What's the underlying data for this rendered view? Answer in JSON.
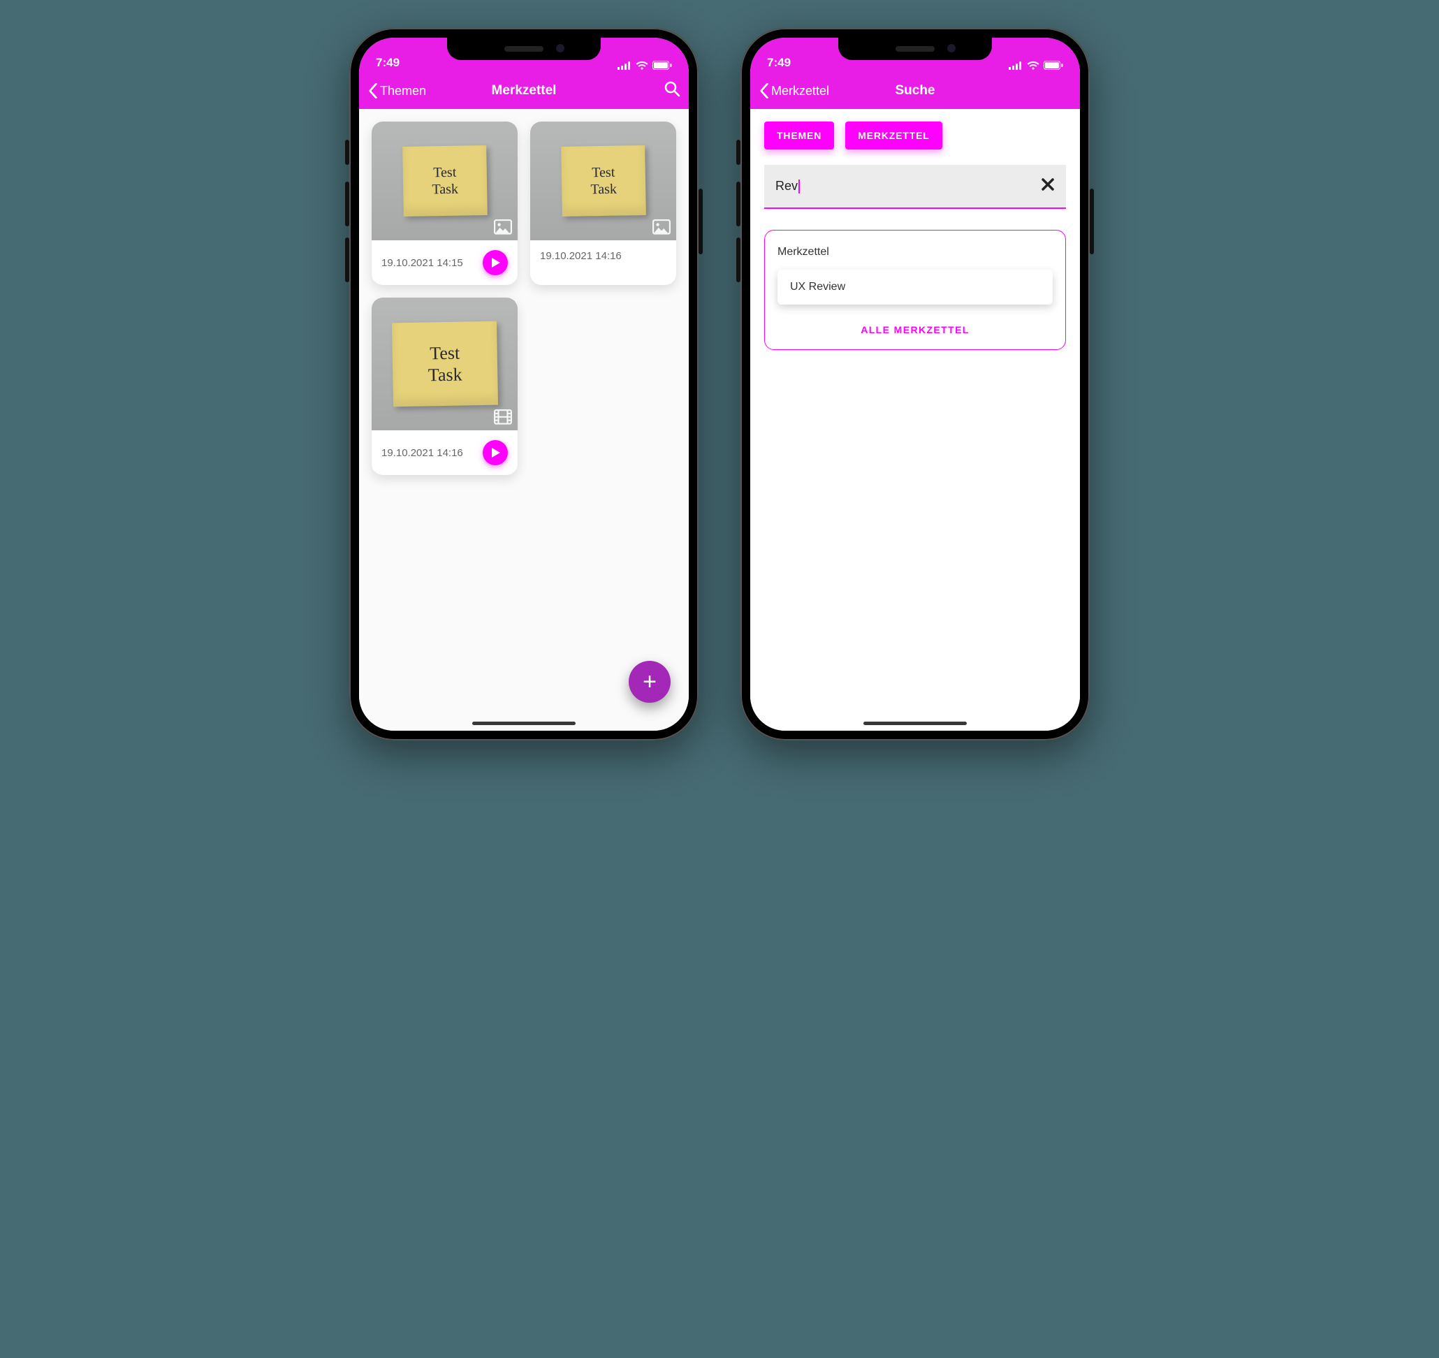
{
  "status": {
    "time": "7:49"
  },
  "left": {
    "nav": {
      "back_label": "Themen",
      "title": "Merkzettel",
      "search_icon": "search-icon"
    },
    "notes": [
      {
        "sticky_text": "Test\nTask",
        "timestamp": "19.10.2021 14:15",
        "media_type": "image",
        "has_play": true
      },
      {
        "sticky_text": "Test\nTask",
        "timestamp": "19.10.2021 14:16",
        "media_type": "image",
        "has_play": false
      },
      {
        "sticky_text": "Test\nTask",
        "timestamp": "19.10.2021 14:16",
        "media_type": "video",
        "has_play": true
      }
    ],
    "fab_label": "+"
  },
  "right": {
    "nav": {
      "back_label": "Merkzettel",
      "title": "Suche"
    },
    "filters": [
      {
        "label": "THEMEN"
      },
      {
        "label": "MERKZETTEL"
      }
    ],
    "search": {
      "value": "Rev",
      "clear_icon": "✕"
    },
    "results": {
      "section_title": "Merkzettel",
      "items": [
        {
          "title": "UX Review"
        }
      ],
      "all_label": "ALLE MERKZETTEL"
    }
  }
}
